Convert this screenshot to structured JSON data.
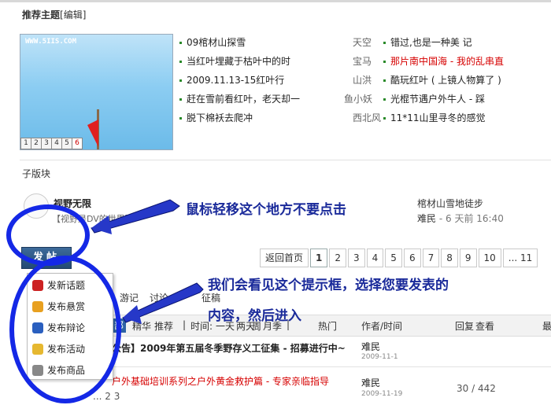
{
  "recommend": {
    "title": "推荐主题",
    "edit": "[编辑]",
    "thumb_site": "WWW.5IIS.COM",
    "thumb_pages": [
      "1",
      "2",
      "3",
      "4",
      "5",
      "6"
    ],
    "left": [
      {
        "title": "09棺材山探雪",
        "author": "天空"
      },
      {
        "title": "当红叶埋藏于枯叶中的时",
        "author": "宝马"
      },
      {
        "title": "2009.11.13-15红叶行",
        "author": "山洪"
      },
      {
        "title": "赶在雪前看红叶，老天却一",
        "author": "鱼小妖"
      },
      {
        "title": "脱下棉袄去爬冲",
        "author": "西北风"
      }
    ],
    "right": [
      {
        "title": "错过,也是一种美  记",
        "red": false
      },
      {
        "title": "那片南中国海 - 我的乱串直",
        "red": true
      },
      {
        "title": "酷玩红叶 ( 上镜人物算了 )",
        "red": false
      },
      {
        "title": "光棍节遇户外牛人  -  踩",
        "red": false
      },
      {
        "title": "11*11山里寻冬的感觉",
        "red": false
      }
    ]
  },
  "subforum": {
    "title": "子版块",
    "name": "视野无限",
    "desc": "【视野是DV的世界】",
    "last_title": "棺材山雪地徒步",
    "last_user": "难民",
    "last_time": "- 6 天前 16:40"
  },
  "post_button": "发帖",
  "pagination": {
    "back": "返回首页",
    "pages": [
      "1",
      "2",
      "3",
      "4",
      "5",
      "6",
      "7",
      "8",
      "9",
      "10",
      "... 11"
    ],
    "current": "1"
  },
  "post_menu": [
    {
      "label": "发新话题",
      "icon": "new-topic-icon",
      "color": "#cc2222"
    },
    {
      "label": "发布悬赏",
      "icon": "reward-icon",
      "color": "#e8a020"
    },
    {
      "label": "发布辩论",
      "icon": "debate-icon",
      "color": "#2a5fbf"
    },
    {
      "label": "发布活动",
      "icon": "activity-icon",
      "color": "#e6b830"
    },
    {
      "label": "发布商品",
      "icon": "goods-icon",
      "color": "#888888"
    }
  ],
  "tabs": [
    "游记",
    "讨论",
    "",
    "征稿"
  ],
  "filter": {
    "all": "部",
    "items": [
      "精华",
      "推荐",
      "|",
      "时间:",
      "一天",
      "两天",
      "周",
      "月",
      "季",
      "|",
      "热门"
    ],
    "col_author": "作者/时间",
    "col_reply": "回复",
    "col_view": "查看",
    "col_last": "最"
  },
  "threads": [
    {
      "title": "公告】2009年第五届冬季野存义工征集 - 招募进行中~",
      "author": "难民",
      "date": "2009-11-1"
    },
    {
      "title": "户外基础培训系列之户外黄金救护篇 - 专家亲临指导",
      "author": "难民",
      "date": "2009-11-19",
      "count": "30 / 442",
      "pages": "... 2  3"
    }
  ],
  "annotations": {
    "hover_tip": "鼠标轻移这个地方不要点击",
    "menu_tip_1": "我们会看见这个提示框，选择您要发表的",
    "menu_tip_2": "内容，然后进入"
  },
  "colors": {
    "accent": "#2e62a6",
    "annotation": "#1a2a9a",
    "link_red": "#d60000"
  }
}
